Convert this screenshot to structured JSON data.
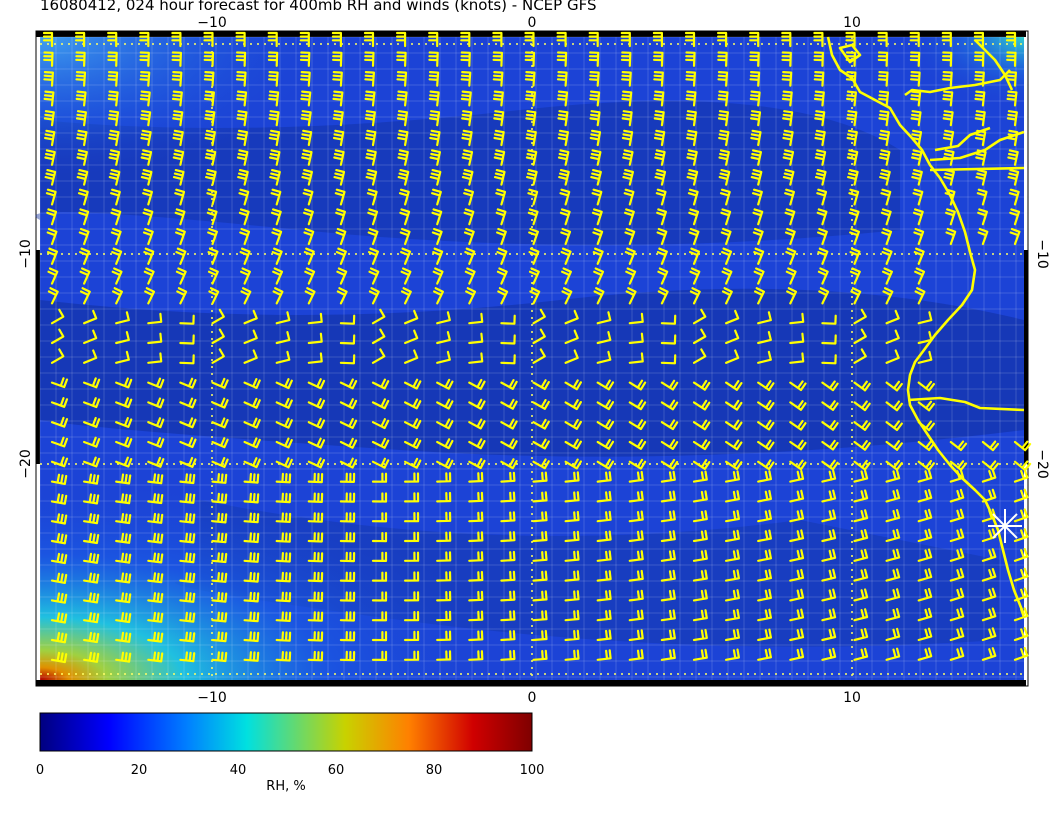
{
  "title": "16080412, 024 hour forecast for 400mb RH and winds (knots) - NCEP GFS",
  "map": {
    "x_ticks": [
      "−10",
      "0",
      "10"
    ],
    "y_ticks": [
      "−10",
      "−20"
    ],
    "coastline_color": "#ffff00",
    "wind_barb_color": "#ffff00",
    "marker": "white-star"
  },
  "colorbar": {
    "label": "RH, %",
    "ticks": [
      "0",
      "20",
      "40",
      "60",
      "80",
      "100"
    ],
    "colors": [
      "#00007f",
      "#0000ff",
      "#007fff",
      "#00e0e0",
      "#c8d200",
      "#ff8000",
      "#d00000",
      "#7f0000"
    ]
  }
}
